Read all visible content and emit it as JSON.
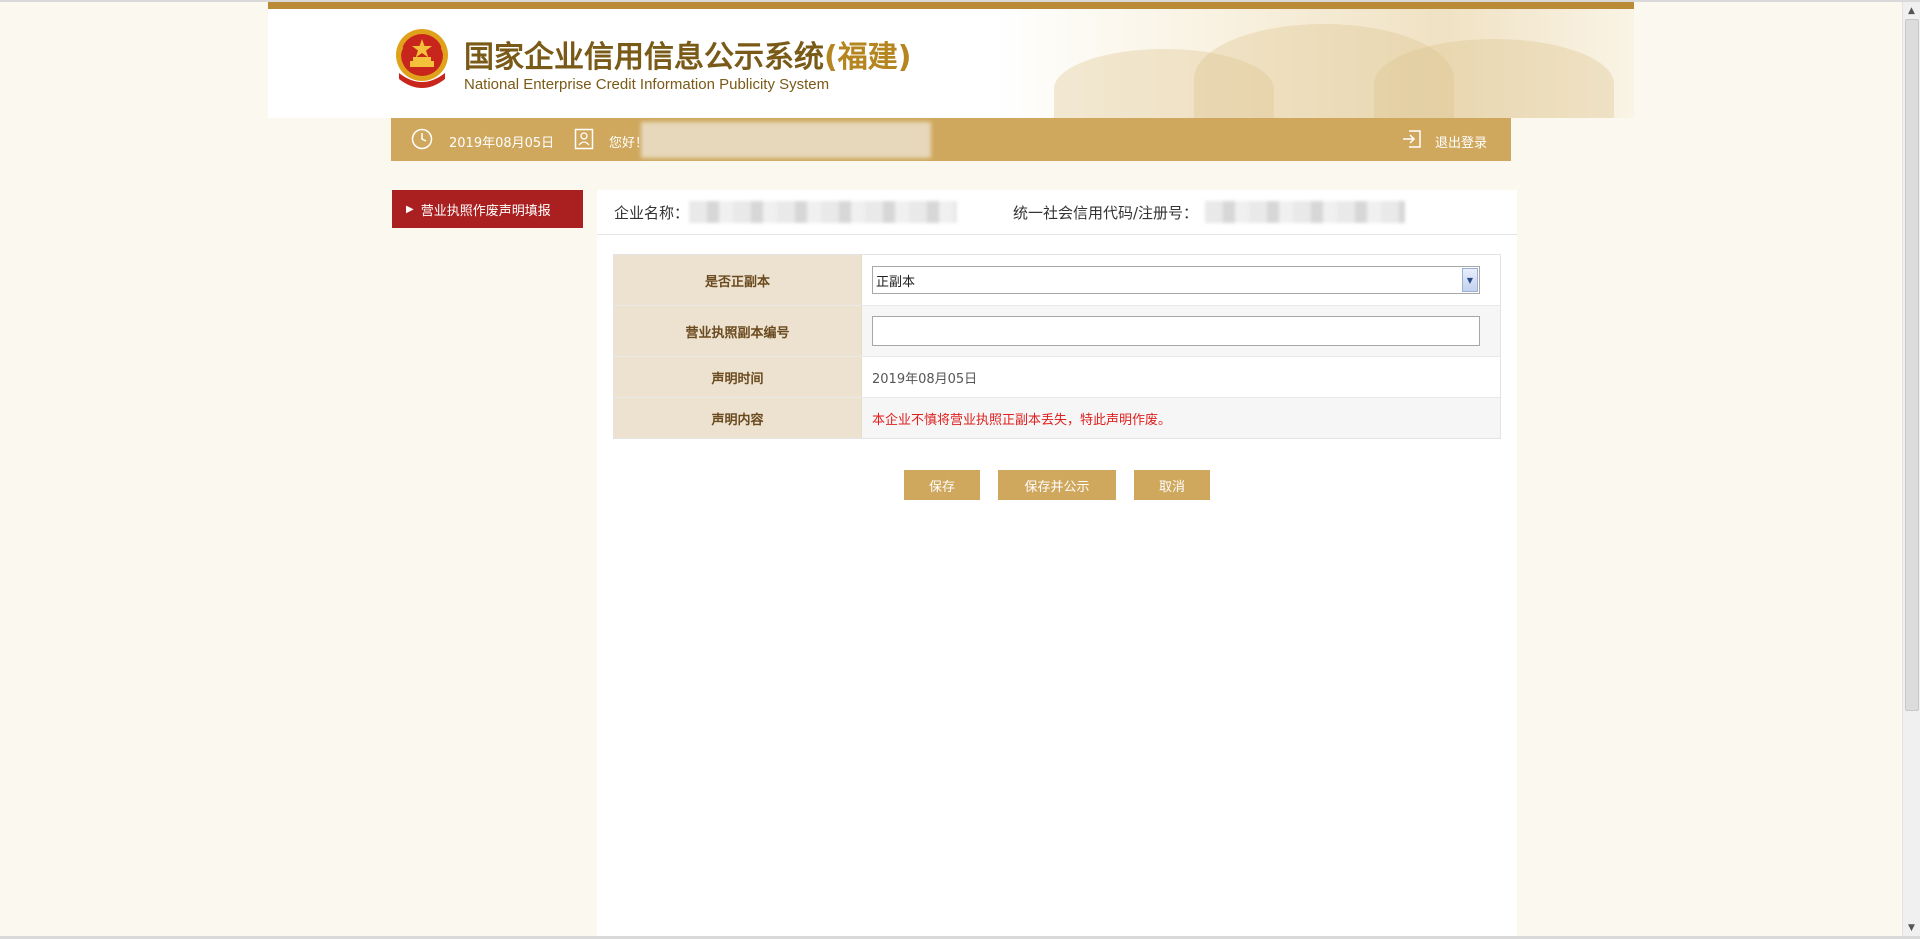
{
  "header": {
    "title_cn": "国家企业信用信息公示系统",
    "title_province": "(福建)",
    "title_en": "National Enterprise Credit Information Publicity System"
  },
  "info_bar": {
    "date": "2019年08月05日",
    "greeting": "您好！",
    "logout_label": "退出登录"
  },
  "sidebar": {
    "items": [
      {
        "label": "营业执照作废声明填报"
      }
    ]
  },
  "company": {
    "name_label": "企业名称：",
    "code_label": "统一社会信用代码/注册号："
  },
  "form": {
    "rows": [
      {
        "label": "是否正副本",
        "value": "正副本"
      },
      {
        "label": "营业执照副本编号",
        "value": ""
      },
      {
        "label": "声明时间",
        "value": "2019年08月05日"
      },
      {
        "label": "声明内容",
        "value": "本企业不慎将营业执照正副本丢失，特此声明作废。"
      }
    ]
  },
  "buttons": {
    "save": "保存",
    "save_publish": "保存并公示",
    "cancel": "取消"
  },
  "colors": {
    "gold": "#cfa75d",
    "dark_gold": "#b98b36",
    "sidebar_red": "#aa1f1f",
    "declaration_red": "#e01f1f",
    "label_bg": "#ece2cf"
  }
}
